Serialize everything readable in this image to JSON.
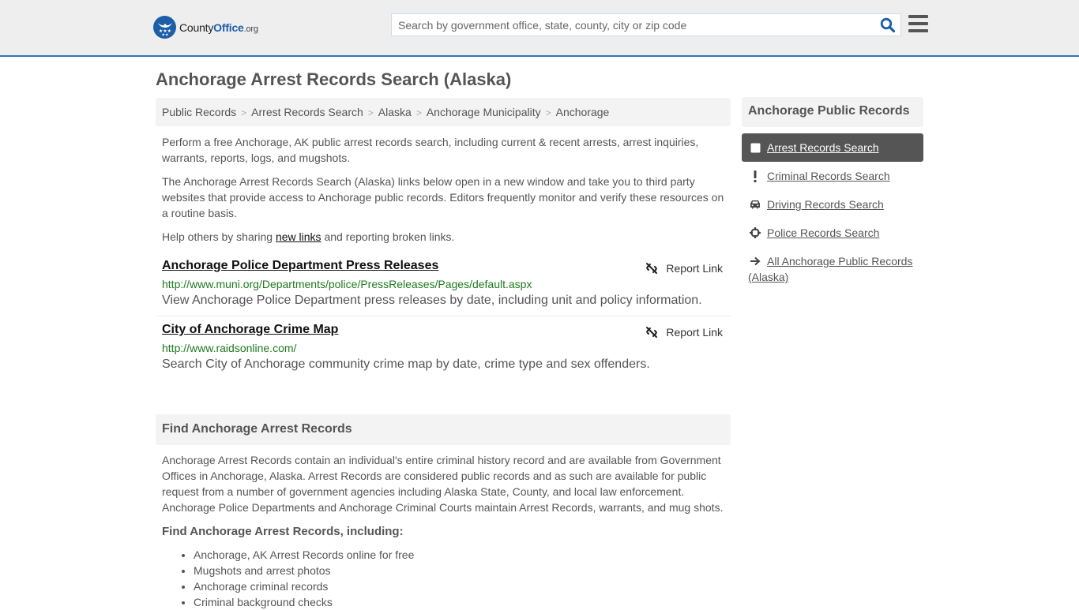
{
  "header": {
    "logo": {
      "county": "County",
      "office": "Office",
      "org": ".org"
    },
    "search_placeholder": "Search by government office, state, county, city or zip code",
    "search_value": "",
    "brand_color": "#1c5ea8",
    "accent_border_color": "#2f77b6"
  },
  "page_title": "Anchorage Arrest Records Search (Alaska)",
  "breadcrumb": [
    {
      "label": "Public Records"
    },
    {
      "label": "Arrest Records Search"
    },
    {
      "label": "Alaska"
    },
    {
      "label": "Anchorage Municipality"
    },
    {
      "label": "Anchorage"
    }
  ],
  "intro": {
    "p1": "Perform a free Anchorage, AK public arrest records search, including current & recent arrests, arrest inquiries, warrants, reports, logs, and mugshots.",
    "p2": "The Anchorage Arrest Records Search (Alaska) links below open in a new window and take you to third party websites that provide access to Anchorage public records. Editors frequently monitor and verify these resources on a routine basis.",
    "p3_before": "Help others by sharing ",
    "p3_link": "new links",
    "p3_after": " and reporting broken links."
  },
  "results": [
    {
      "title": "Anchorage Police Department Press Releases",
      "url": "http://www.muni.org/Departments/police/PressReleases/Pages/default.aspx",
      "description": "View Anchorage Police Department press releases by date, including unit and policy information.",
      "report_label": "Report Link"
    },
    {
      "title": "City of Anchorage Crime Map",
      "url": "http://www.raidsonline.com/",
      "description": "Search City of Anchorage community crime map by date, crime type and sex offenders.",
      "report_label": "Report Link"
    }
  ],
  "find_section": {
    "heading": "Find Anchorage Arrest Records",
    "body": "Anchorage Arrest Records contain an individual's entire criminal history record and are available from Government Offices in Anchorage, Alaska. Arrest Records are considered public records and as such are available for public request from a number of government agencies including Alaska State, County, and local law enforcement. Anchorage Police Departments and Anchorage Criminal Courts maintain Arrest Records, warrants, and mug shots.",
    "subheading": "Find Anchorage Arrest Records, including:",
    "items": [
      "Anchorage, AK Arrest Records online for free",
      "Mugshots and arrest photos",
      "Anchorage criminal records",
      "Criminal background checks"
    ]
  },
  "sidebar": {
    "heading": "Anchorage Public Records",
    "items": [
      {
        "label": "Arrest Records Search",
        "icon": "square-icon",
        "active": true
      },
      {
        "label": "Criminal Records Search",
        "icon": "exclamation-icon",
        "active": false
      },
      {
        "label": "Driving Records Search",
        "icon": "car-icon",
        "active": false
      },
      {
        "label": "Police Records Search",
        "icon": "crosshairs-icon",
        "active": false
      },
      {
        "label": "All Anchorage Public Records (Alaska)",
        "icon": "arrow-right-icon",
        "active": false
      }
    ]
  }
}
